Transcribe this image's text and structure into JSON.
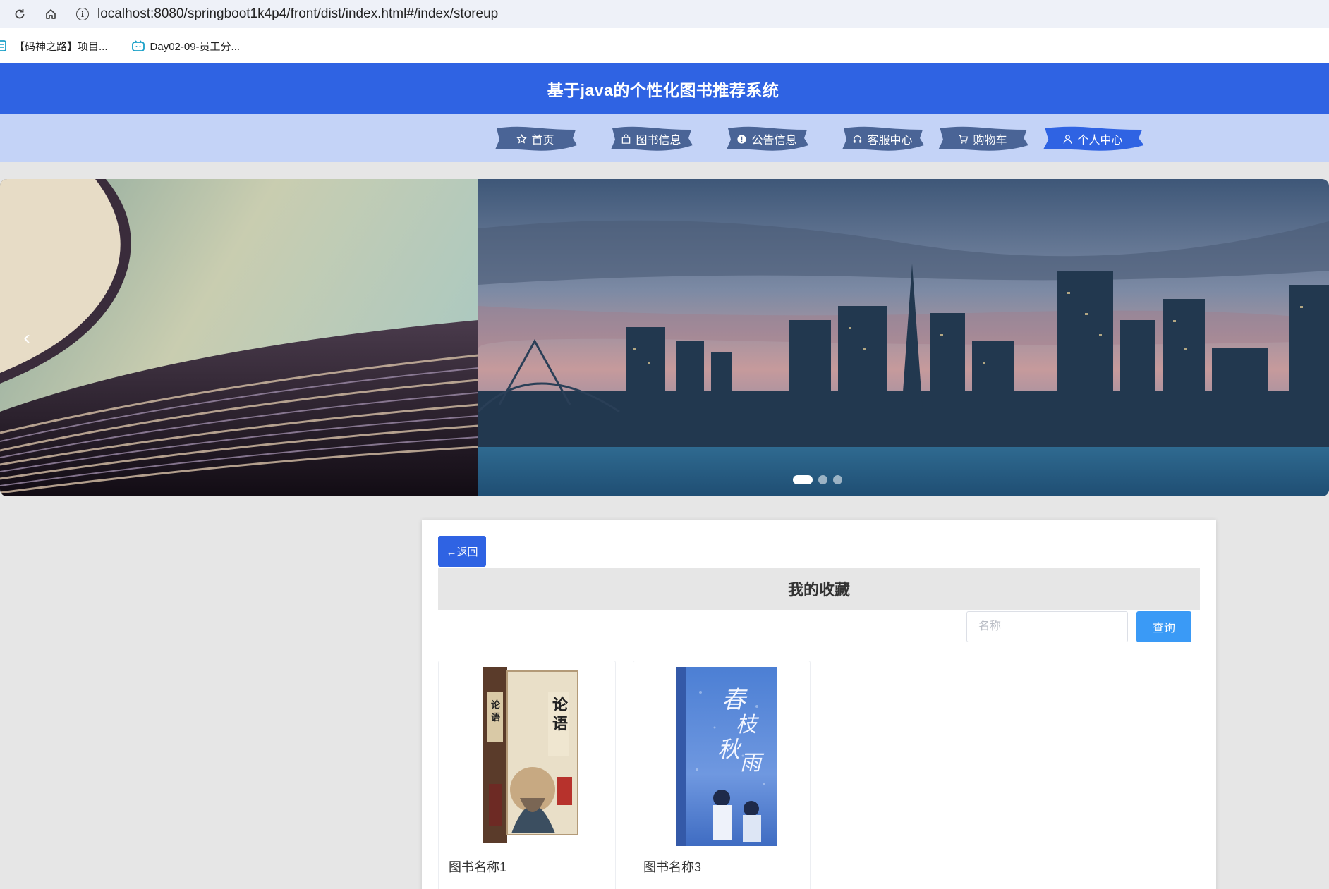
{
  "browser": {
    "url": "localhost:8080/springboot1k4p4/front/dist/index.html#/index/storeup",
    "bookmarks": [
      {
        "label": "【码神之路】项目..."
      },
      {
        "label": "Day02-09-员工分..."
      }
    ]
  },
  "site": {
    "title": "基于java的个性化图书推荐系统",
    "nav": [
      {
        "label": "首页",
        "icon": "star-icon"
      },
      {
        "label": "图书信息",
        "icon": "bag-icon"
      },
      {
        "label": "公告信息",
        "icon": "alert-circle-icon"
      },
      {
        "label": "客服中心",
        "icon": "headset-icon"
      },
      {
        "label": "购物车",
        "icon": "cart-icon"
      },
      {
        "label": "个人中心",
        "icon": "user-icon"
      }
    ],
    "active_nav": "个人中心",
    "colors": {
      "primary": "#2f63e3",
      "nav_bg": "#c4d3f7",
      "brush": "#4a6496",
      "brush_active": "#2f63e3",
      "search_btn": "#3a9af6"
    }
  },
  "carousel": {
    "slides": 3,
    "active_slide": 1,
    "prev_glyph": "‹"
  },
  "storeup": {
    "back_label": "←返回",
    "title": "我的收藏",
    "search": {
      "placeholder": "名称",
      "button": "查询"
    },
    "items": [
      {
        "name": "图书名称1"
      },
      {
        "name": "图书名称3"
      }
    ]
  }
}
